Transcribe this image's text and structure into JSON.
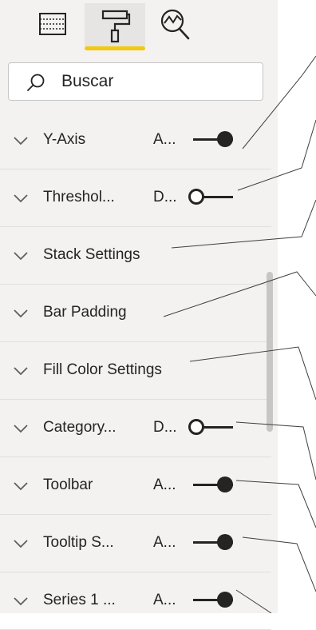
{
  "tabs": [
    {
      "name": "fields"
    },
    {
      "name": "format",
      "active": true
    },
    {
      "name": "analytics"
    }
  ],
  "search": {
    "placeholder": "Buscar",
    "value": ""
  },
  "rows": [
    {
      "label": "Y-Axis",
      "value": "A...",
      "toggle": "on"
    },
    {
      "label": "Threshol...",
      "value": "D...",
      "toggle": "off"
    },
    {
      "label": "Stack Settings",
      "value": "",
      "toggle": null
    },
    {
      "label": "Bar Padding",
      "value": "",
      "toggle": null
    },
    {
      "label": "Fill Color Settings",
      "value": "",
      "toggle": null
    },
    {
      "label": "Category...",
      "value": "D...",
      "toggle": "off"
    },
    {
      "label": "Toolbar",
      "value": "A...",
      "toggle": "on"
    },
    {
      "label": "Tooltip S...",
      "value": "A...",
      "toggle": "on"
    },
    {
      "label": "Series 1 ...",
      "value": "A...",
      "toggle": "on"
    }
  ],
  "colors": {
    "accent": "#f2c811",
    "panel": "#f3f2f1",
    "text": "#252423"
  }
}
